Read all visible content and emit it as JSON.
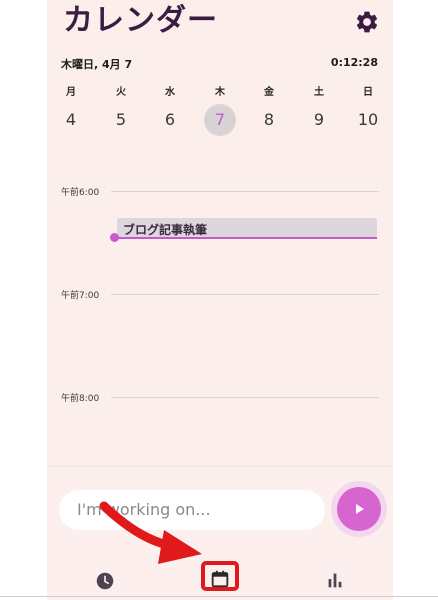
{
  "header": {
    "title": "カレンダー",
    "settings_icon": "gear-icon"
  },
  "status": {
    "date": "木曜日, 4月 7",
    "elapsed": "0:12:28"
  },
  "week": [
    {
      "dow": "月",
      "num": "4"
    },
    {
      "dow": "火",
      "num": "5"
    },
    {
      "dow": "水",
      "num": "6"
    },
    {
      "dow": "木",
      "num": "7",
      "selected": true
    },
    {
      "dow": "金",
      "num": "8"
    },
    {
      "dow": "土",
      "num": "9"
    },
    {
      "dow": "日",
      "num": "10"
    }
  ],
  "timeline": {
    "hours": [
      "午前6:00",
      "午前7:00",
      "午前8:00"
    ],
    "event": {
      "title": "ブログ記事執筆"
    }
  },
  "composer": {
    "placeholder": "I'm working on...",
    "start_icon": "play-icon"
  },
  "bottom_nav": {
    "items": [
      {
        "icon": "clock-icon"
      },
      {
        "icon": "calendar-icon",
        "selected": true
      },
      {
        "icon": "bar-chart-icon"
      }
    ]
  },
  "colors": {
    "background": "#fbeeeb",
    "title": "#3b1d44",
    "accent": "#d665cf",
    "today_text": "#c060c0",
    "event_bg": "#ddd6dc",
    "annotation": "#e01a1a"
  }
}
